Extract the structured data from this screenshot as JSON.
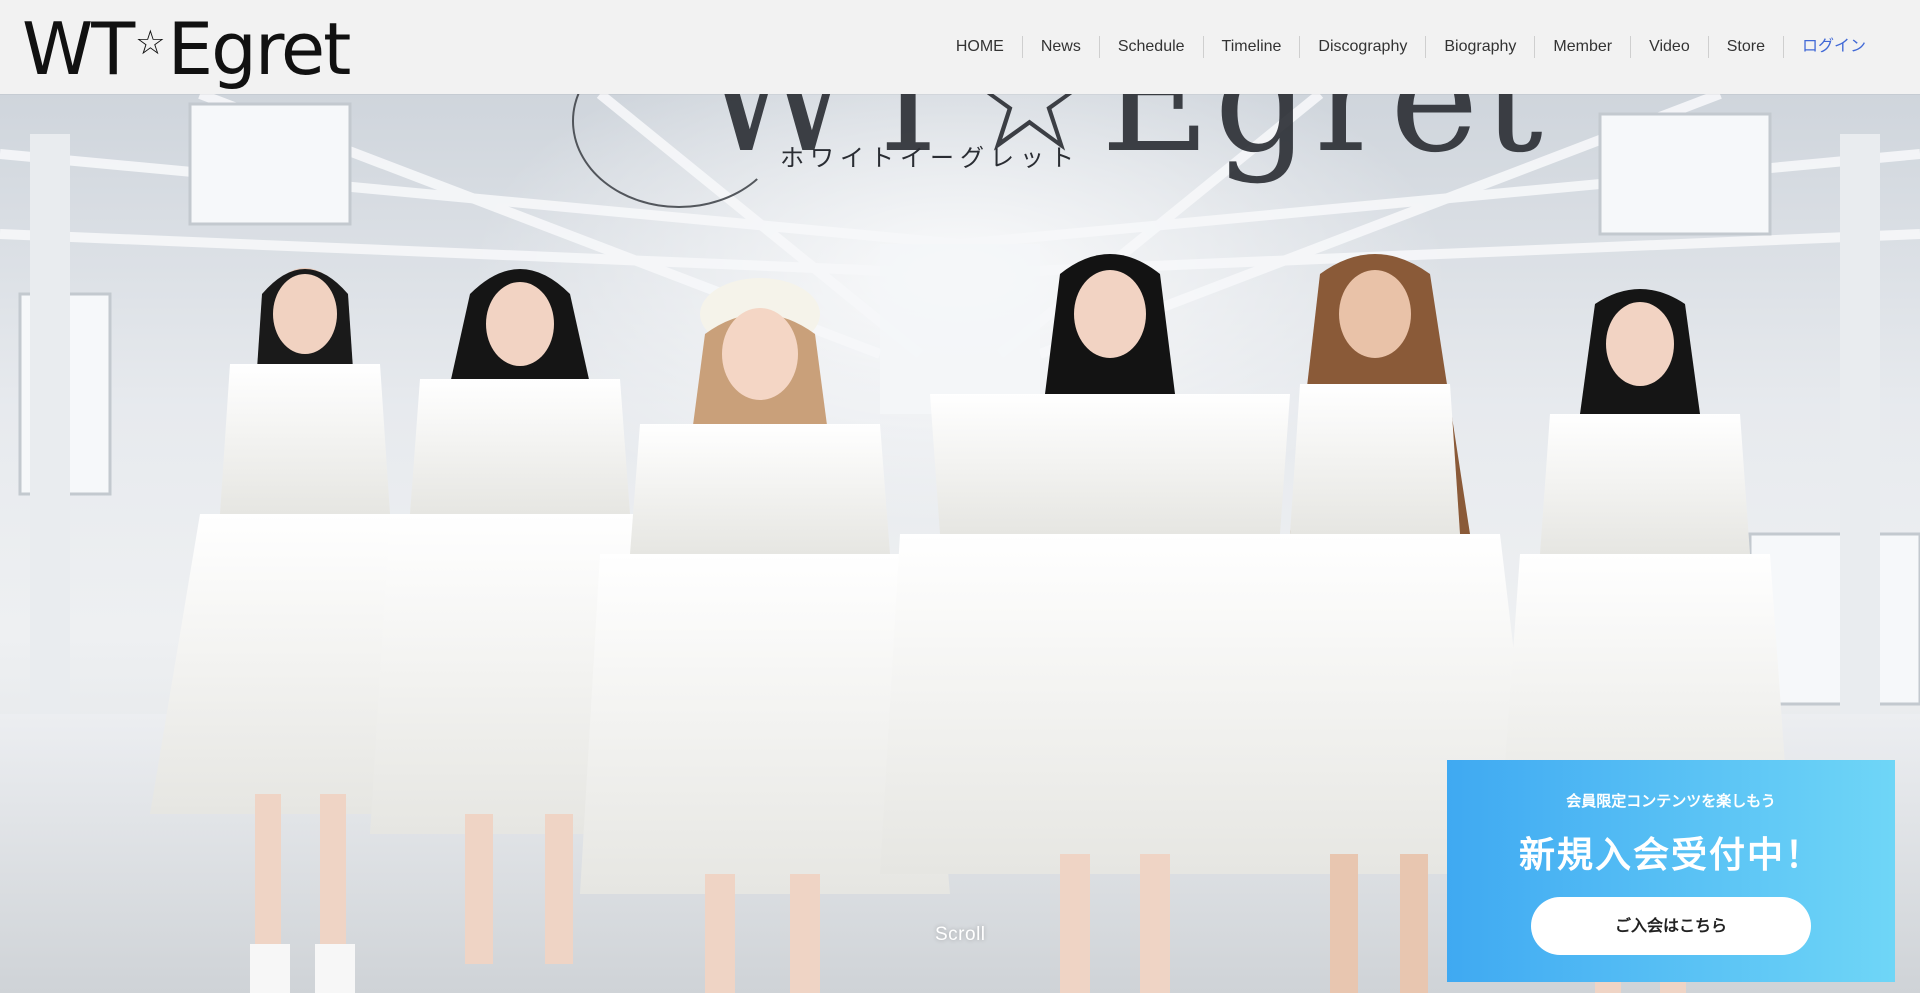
{
  "header": {
    "logo_text_left": "WT",
    "logo_star": "☆",
    "logo_text_right": "Egret",
    "nav": [
      {
        "label": "HOME"
      },
      {
        "label": "News"
      },
      {
        "label": "Schedule"
      },
      {
        "label": "Timeline"
      },
      {
        "label": "Discography"
      },
      {
        "label": "Biography"
      },
      {
        "label": "Member"
      },
      {
        "label": "Video"
      },
      {
        "label": "Store"
      },
      {
        "label": "ログイン"
      }
    ],
    "login_color": "#4169d6"
  },
  "hero": {
    "logo_word": "WT☆Egret",
    "logo_kana": "ホワイトイーグレット",
    "scroll_label": "Scroll",
    "image": "group-photo-six-members-white-dresses"
  },
  "join_card": {
    "subtitle": "会員限定コンテンツを楽しもう",
    "title": "新規入会受付中！",
    "button_label": "ご入会はこちら",
    "gradient_start": "#3fa9f2",
    "gradient_end": "#6fd6f7"
  }
}
